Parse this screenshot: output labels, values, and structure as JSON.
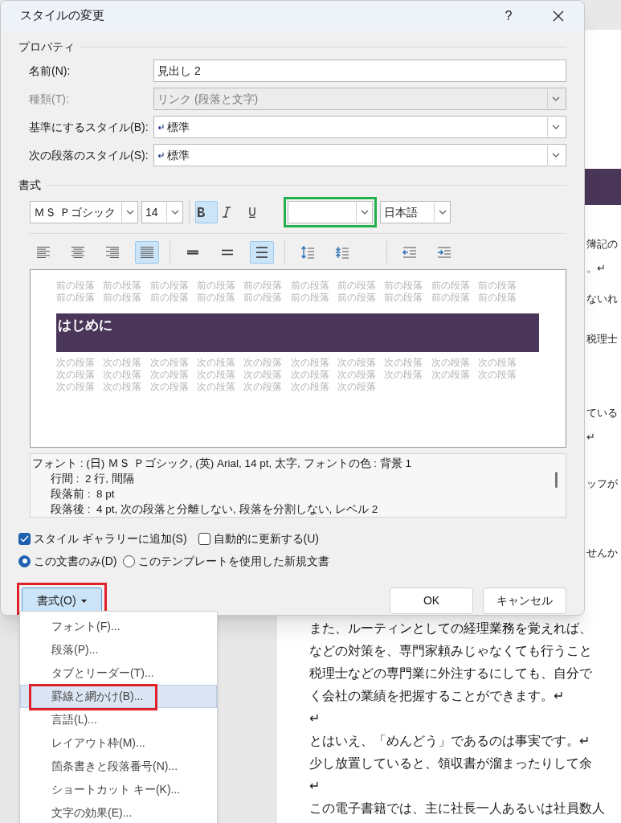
{
  "dialog": {
    "title": "スタイルの変更",
    "help": "?",
    "properties": {
      "heading": "プロパティ",
      "fields": [
        {
          "label": "名前(N):",
          "kind": "text",
          "value": "見出し 2",
          "disabled": false
        },
        {
          "label": "種類(T):",
          "kind": "dropdown",
          "value": "リンク (段落と文字)",
          "disabled": true
        },
        {
          "label": "基準にするスタイル(B):",
          "kind": "style_dropdown",
          "value": "標準",
          "disabled": false
        },
        {
          "label": "次の段落のスタイル(S):",
          "kind": "style_dropdown",
          "value": "標準",
          "disabled": false
        }
      ]
    },
    "formatting": {
      "heading": "書式",
      "font": "ＭＳ Ｐゴシック",
      "size": "14",
      "bold": true,
      "italic": false,
      "underline": false,
      "color_highlighted": true,
      "language": "日本語",
      "alignment": [
        {
          "selected": false
        },
        {
          "selected": false
        },
        {
          "selected": false
        },
        {
          "selected": true
        }
      ],
      "spacing": [
        {
          "selected": false
        },
        {
          "selected": false
        },
        {
          "selected": true
        }
      ]
    },
    "preview": {
      "before": [
        "前の段落 前の段落 前の段落 前の段落 前の段落 前の段落 前の段落 前の段落 前の段落 前の段落",
        "前の段落 前の段落 前の段落 前の段落 前の段落 前の段落 前の段落 前の段落 前の段落 前の段落"
      ],
      "heading": "はじめに",
      "after": [
        "次の段落 次の段落 次の段落 次の段落 次の段落 次の段落 次の段落 次の段落 次の段落 次の段落",
        "次の段落 次の段落 次の段落 次の段落 次の段落 次の段落 次の段落 次の段落 次の段落 次の段落",
        "次の段落 次の段落 次の段落 次の段落 次の段落 次の段落 次の段落"
      ]
    },
    "description": [
      "フォント : (日) ＭＳ Ｐゴシック, (英) Arial, 14 pt, 太字, フォントの色 : 背景 1",
      "行間 :  2 行, 間隔",
      "段落前 :  8 pt",
      "段落後 :  4 pt, 次の段落と分離しない, 段落を分割しない, レベル 2"
    ],
    "checkboxes": [
      {
        "label": "スタイル ギャラリーに追加(S)",
        "checked": true
      },
      {
        "label": "自動的に更新する(U)",
        "checked": false
      }
    ],
    "scope": [
      {
        "label": "この文書のみ(D)",
        "selected": true
      },
      {
        "label": "このテンプレートを使用した新規文書",
        "selected": false
      }
    ],
    "format_button": {
      "label": "書式(O)",
      "highlighted": true
    },
    "buttons": [
      "OK",
      "キャンセル"
    ]
  },
  "format_menu": {
    "items": [
      {
        "label": "フォント(F)...",
        "selected": false,
        "highlighted": false
      },
      {
        "label": "段落(P)...",
        "selected": false,
        "highlighted": false
      },
      {
        "label": "タブとリーダー(T)...",
        "selected": false,
        "highlighted": false
      },
      {
        "label": "罫線と網かけ(B)...",
        "selected": true,
        "highlighted": true
      },
      {
        "label": "言語(L)...",
        "selected": false,
        "highlighted": false
      },
      {
        "label": "レイアウト枠(M)...",
        "selected": false,
        "highlighted": false
      },
      {
        "label": "箇条書きと段落番号(N)...",
        "selected": false,
        "highlighted": false
      },
      {
        "label": "ショートカット キー(K)...",
        "selected": false,
        "highlighted": false
      },
      {
        "label": "文字の効果(E)...",
        "selected": false,
        "highlighted": false
      }
    ]
  },
  "document": {
    "fragments": [
      "簿記の",
      "。↵",
      "ないれ",
      "税理士",
      "ている",
      "↵",
      "ッフが",
      "せんか"
    ],
    "lines": [
      "また、ルーティンとしての経理業務を覚えれば、",
      "などの対策を、専門家頼みじゃなくても行うこと",
      "税理士などの専門業に外注するにしても、自分で",
      "く会社の業績を把握することができます。↵",
      "↵",
      "とはいえ、「めんどう」であるのは事実です。↵",
      "少し放置していると、領収書が溜まったりして余",
      "↵",
      "この電子書籍では、主に社長一人あるいは社員数人"
    ]
  }
}
